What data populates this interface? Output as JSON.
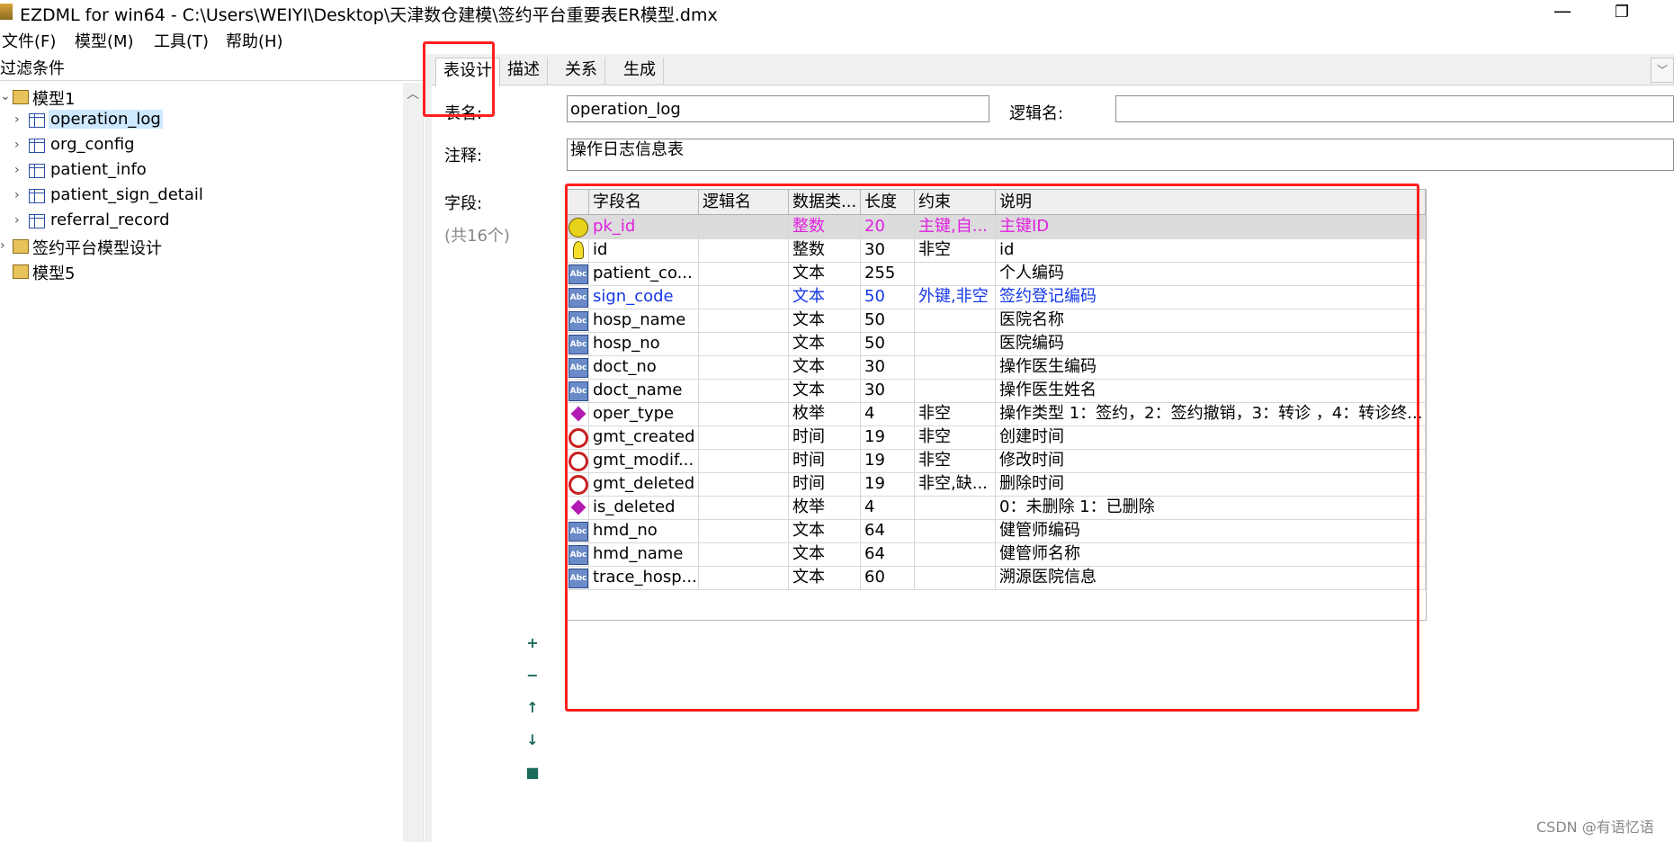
{
  "window": {
    "title": "EZDML for win64 - C:\\Users\\WEIYI\\Desktop\\天津数仓建模\\签约平台重要表ER模型.dmx",
    "minimize_glyph": "—",
    "maximize_glyph": "❐"
  },
  "menu": [
    {
      "label": "文件(F)"
    },
    {
      "label": "模型(M)"
    },
    {
      "label": "工具(T)"
    },
    {
      "label": "帮助(H)"
    }
  ],
  "left_panel": {
    "filter_label": "过滤条件",
    "tree": [
      {
        "label": "模型1",
        "expanded": true,
        "icon": "folder-icon"
      },
      {
        "label": "operation_log",
        "icon": "table-icon",
        "selected": true
      },
      {
        "label": "org_config",
        "icon": "table-icon"
      },
      {
        "label": "patient_info",
        "icon": "table-icon"
      },
      {
        "label": "patient_sign_detail",
        "icon": "table-icon"
      },
      {
        "label": "referral_record",
        "icon": "table-icon"
      },
      {
        "label": "签约平台模型设计",
        "icon": "folder-icon"
      },
      {
        "label": "模型5",
        "icon": "folder-icon"
      }
    ]
  },
  "tabs": [
    {
      "label": "表设计",
      "active": true
    },
    {
      "label": "描述"
    },
    {
      "label": "关系"
    },
    {
      "label": "生成"
    }
  ],
  "form": {
    "table_name_label": "表名:",
    "table_name_value": "operation_log",
    "logic_name_label": "逻辑名:",
    "logic_name_value": "",
    "comment_label": "注释:",
    "comment_value": "操作日志信息表",
    "fields_label": "字段:",
    "fields_count": "(共16个)"
  },
  "side_buttons": [
    "+",
    "−",
    "↑",
    "↓",
    "■"
  ],
  "grid": {
    "columns": [
      "字段名",
      "逻辑名",
      "数据类...",
      "长度",
      "约束",
      "说明"
    ],
    "rows": [
      {
        "icon": "primary-key-icon",
        "name": "pk_id",
        "logic": "",
        "type": "整数",
        "length": "20",
        "constraint": "主键,自...",
        "desc": "主键ID",
        "color": "magenta",
        "selected": true
      },
      {
        "icon": "id-bulb-icon",
        "name": "id",
        "logic": "",
        "type": "整数",
        "length": "30",
        "constraint": "非空",
        "desc": "id"
      },
      {
        "icon": "text-type-icon",
        "name": "patient_co...",
        "logic": "",
        "type": "文本",
        "length": "255",
        "constraint": "",
        "desc": "个人编码"
      },
      {
        "icon": "text-type-icon",
        "name": "sign_code",
        "logic": "",
        "type": "文本",
        "length": "50",
        "constraint": "外键,非空",
        "desc": "签约登记编码",
        "color": "blue"
      },
      {
        "icon": "text-type-icon",
        "name": "hosp_name",
        "logic": "",
        "type": "文本",
        "length": "50",
        "constraint": "",
        "desc": "医院名称"
      },
      {
        "icon": "text-type-icon",
        "name": "hosp_no",
        "logic": "",
        "type": "文本",
        "length": "50",
        "constraint": "",
        "desc": "医院编码"
      },
      {
        "icon": "text-type-icon",
        "name": "doct_no",
        "logic": "",
        "type": "文本",
        "length": "30",
        "constraint": "",
        "desc": "操作医生编码"
      },
      {
        "icon": "text-type-icon",
        "name": "doct_name",
        "logic": "",
        "type": "文本",
        "length": "30",
        "constraint": "",
        "desc": "操作医生姓名"
      },
      {
        "icon": "enum-type-icon",
        "name": "oper_type",
        "logic": "",
        "type": "枚举",
        "length": "4",
        "constraint": "非空",
        "desc": "操作类型 1：签约，2：签约撤销，3：转诊 ，4：转诊终..."
      },
      {
        "icon": "time-type-icon",
        "name": "gmt_created",
        "logic": "",
        "type": "时间",
        "length": "19",
        "constraint": "非空",
        "desc": "创建时间"
      },
      {
        "icon": "time-type-icon",
        "name": "gmt_modif...",
        "logic": "",
        "type": "时间",
        "length": "19",
        "constraint": "非空",
        "desc": "修改时间"
      },
      {
        "icon": "time-type-icon",
        "name": "gmt_deleted",
        "logic": "",
        "type": "时间",
        "length": "19",
        "constraint": "非空,缺...",
        "desc": "删除时间"
      },
      {
        "icon": "enum-type-icon",
        "name": "is_deleted",
        "logic": "",
        "type": "枚举",
        "length": "4",
        "constraint": "",
        "desc": "0：未删除 1：已删除"
      },
      {
        "icon": "text-type-icon",
        "name": "hmd_no",
        "logic": "",
        "type": "文本",
        "length": "64",
        "constraint": "",
        "desc": "健管师编码"
      },
      {
        "icon": "text-type-icon",
        "name": "hmd_name",
        "logic": "",
        "type": "文本",
        "length": "64",
        "constraint": "",
        "desc": "健管师名称"
      },
      {
        "icon": "text-type-icon",
        "name": "trace_hosp...",
        "logic": "",
        "type": "文本",
        "length": "60",
        "constraint": "",
        "desc": "溯源医院信息"
      }
    ]
  },
  "colors": {
    "magenta": "#e020e0",
    "blue": "#1538e8",
    "annotation_red": "#ff2020",
    "selection": "#cde8ff"
  },
  "watermark": "CSDN @有语忆语"
}
